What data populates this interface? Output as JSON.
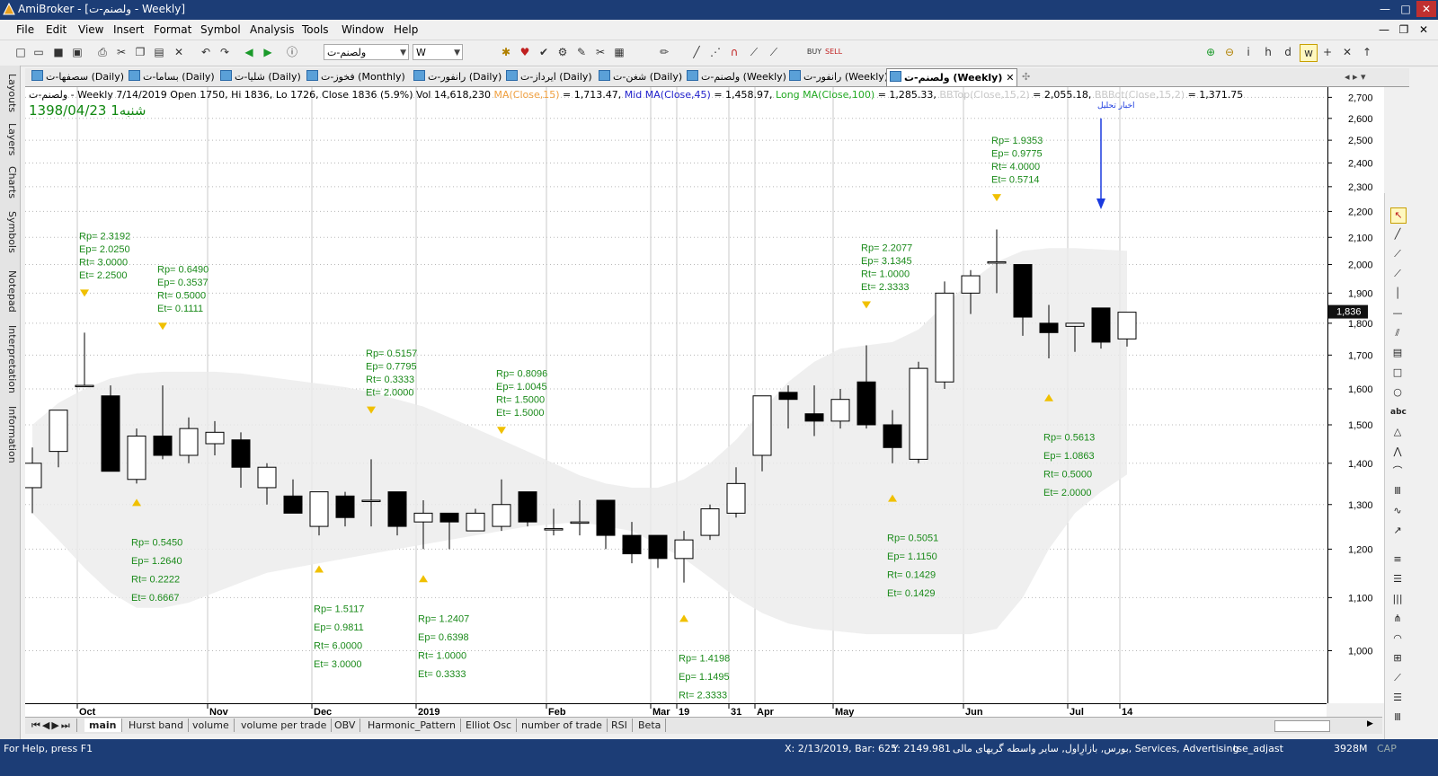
{
  "window": {
    "title": "AmiBroker - [ولصنم-ت - Weekly]",
    "controls": [
      "—",
      "□",
      "✕"
    ],
    "mdi_controls": [
      "—",
      "❐",
      "✕"
    ]
  },
  "menu": [
    "File",
    "Edit",
    "View",
    "Insert",
    "Format",
    "Symbol",
    "Analysis",
    "Tools",
    "Window",
    "Help"
  ],
  "toolbar": {
    "symbol_combo": "ولصنم-ت",
    "interval_combo": "W"
  },
  "left_tabs": [
    "Layouts",
    "Layers",
    "Charts",
    "Symbols",
    "Notepad",
    "Interpretation",
    "Information"
  ],
  "doc_tabs": [
    {
      "label": "سصفها-ت (Daily)",
      "active": false
    },
    {
      "label": "بساما-ت (Daily)",
      "active": false
    },
    {
      "label": "شلیا-ت (Daily)",
      "active": false
    },
    {
      "label": "فخوز-ت (Monthly)",
      "active": false
    },
    {
      "label": "رانفور-ت (Daily)",
      "active": false
    },
    {
      "label": "ایرداز-ت (Daily)",
      "active": false
    },
    {
      "label": "شغن-ت (Daily)",
      "active": false
    },
    {
      "label": "ولصنم-ت (Weekly)",
      "active": false
    },
    {
      "label": "رانفور-ت (Weekly)",
      "active": false
    },
    {
      "label": "ولصنم-ت (Weekly)",
      "active": true
    }
  ],
  "chart_header": {
    "prefix": "ولصنم-ت - Weekly 7/14/2019 Open 1750, Hi 1836, Lo 1726, Close 1836 (5.9%) Vol 14,618,230",
    "ma_label": "MA(Close,15)",
    "ma_value": "= 1,713.47,",
    "mid_label": "Mid MA(Close,45)",
    "mid_value": "= 1,458.97,",
    "long_label": "Long MA(Close,100)",
    "long_value": "= 1,285.33,",
    "bbtop_label": "BBTop(Close,15,2)",
    "bbtop_value": "= 2,055.18,",
    "bbbot_label": "BBBot(Close,15,2)",
    "bbbot_value": "= 1,371.75",
    "colors": {
      "ma": "#f0a040",
      "mid": "#2222cc",
      "long": "#22aa22",
      "bb": "#c8c8c8"
    }
  },
  "jalali_date": "1398/04/23 شنبه1",
  "annotation_text": "اخبار تحلیل",
  "chart_data": {
    "type": "candlestick",
    "ylim": [
      910,
      2750
    ],
    "y_scale": "log",
    "y_ticks": [
      1000,
      1100,
      1200,
      1300,
      1400,
      1500,
      1600,
      1700,
      1800,
      1900,
      2000,
      2100,
      2200,
      2300,
      2400,
      2500,
      2600,
      2700
    ],
    "last_price_label": "1,836",
    "candles": [
      {
        "o": 1340,
        "h": 1440,
        "l": 1280,
        "c": 1400
      },
      {
        "o": 1430,
        "h": 1540,
        "l": 1390,
        "c": 1540
      },
      {
        "o": 1610,
        "h": 1770,
        "l": 1610,
        "c": 1610
      },
      {
        "o": 1580,
        "h": 1610,
        "l": 1380,
        "c": 1380
      },
      {
        "o": 1360,
        "h": 1490,
        "l": 1350,
        "c": 1470
      },
      {
        "o": 1470,
        "h": 1610,
        "l": 1410,
        "c": 1420
      },
      {
        "o": 1420,
        "h": 1520,
        "l": 1400,
        "c": 1490
      },
      {
        "o": 1450,
        "h": 1510,
        "l": 1420,
        "c": 1480
      },
      {
        "o": 1460,
        "h": 1480,
        "l": 1340,
        "c": 1390
      },
      {
        "o": 1340,
        "h": 1400,
        "l": 1300,
        "c": 1390
      },
      {
        "o": 1320,
        "h": 1360,
        "l": 1280,
        "c": 1280
      },
      {
        "o": 1250,
        "h": 1330,
        "l": 1230,
        "c": 1330
      },
      {
        "o": 1320,
        "h": 1330,
        "l": 1250,
        "c": 1270
      },
      {
        "o": 1310,
        "h": 1410,
        "l": 1250,
        "c": 1310
      },
      {
        "o": 1330,
        "h": 1330,
        "l": 1230,
        "c": 1250
      },
      {
        "o": 1260,
        "h": 1310,
        "l": 1200,
        "c": 1280
      },
      {
        "o": 1280,
        "h": 1280,
        "l": 1200,
        "c": 1260
      },
      {
        "o": 1240,
        "h": 1290,
        "l": 1240,
        "c": 1280
      },
      {
        "o": 1250,
        "h": 1360,
        "l": 1240,
        "c": 1300
      },
      {
        "o": 1330,
        "h": 1330,
        "l": 1250,
        "c": 1260
      },
      {
        "o": 1245,
        "h": 1290,
        "l": 1230,
        "c": 1245
      },
      {
        "o": 1260,
        "h": 1310,
        "l": 1230,
        "c": 1260
      },
      {
        "o": 1310,
        "h": 1310,
        "l": 1200,
        "c": 1230
      },
      {
        "o": 1230,
        "h": 1260,
        "l": 1170,
        "c": 1190
      },
      {
        "o": 1230,
        "h": 1230,
        "l": 1160,
        "c": 1180
      },
      {
        "o": 1180,
        "h": 1240,
        "l": 1130,
        "c": 1220
      },
      {
        "o": 1230,
        "h": 1300,
        "l": 1220,
        "c": 1290
      },
      {
        "o": 1280,
        "h": 1390,
        "l": 1270,
        "c": 1350
      },
      {
        "o": 1420,
        "h": 1580,
        "l": 1380,
        "c": 1580
      },
      {
        "o": 1590,
        "h": 1610,
        "l": 1490,
        "c": 1570
      },
      {
        "o": 1530,
        "h": 1610,
        "l": 1470,
        "c": 1510
      },
      {
        "o": 1510,
        "h": 1600,
        "l": 1490,
        "c": 1570
      },
      {
        "o": 1620,
        "h": 1730,
        "l": 1490,
        "c": 1500
      },
      {
        "o": 1500,
        "h": 1540,
        "l": 1400,
        "c": 1440
      },
      {
        "o": 1410,
        "h": 1680,
        "l": 1400,
        "c": 1660
      },
      {
        "o": 1620,
        "h": 1940,
        "l": 1600,
        "c": 1900
      },
      {
        "o": 1900,
        "h": 1980,
        "l": 1830,
        "c": 1960
      },
      {
        "o": 2010,
        "h": 2130,
        "l": 1900,
        "c": 2010
      },
      {
        "o": 2000,
        "h": 2000,
        "l": 1760,
        "c": 1820
      },
      {
        "o": 1800,
        "h": 1860,
        "l": 1690,
        "c": 1770
      },
      {
        "o": 1790,
        "h": 1800,
        "l": 1710,
        "c": 1800
      },
      {
        "o": 1850,
        "h": 1850,
        "l": 1720,
        "c": 1740
      },
      {
        "o": 1750,
        "h": 1836,
        "l": 1726,
        "c": 1836
      }
    ],
    "bb_top": [
      1500,
      1560,
      1600,
      1630,
      1645,
      1650,
      1650,
      1650,
      1645,
      1635,
      1625,
      1615,
      1605,
      1590,
      1570,
      1550,
      1520,
      1490,
      1460,
      1430,
      1400,
      1370,
      1350,
      1340,
      1340,
      1360,
      1400,
      1460,
      1540,
      1620,
      1680,
      1720,
      1730,
      1740,
      1780,
      1860,
      1940,
      2010,
      2050,
      2060,
      2060,
      2055,
      2050
    ],
    "bb_bot": [
      1280,
      1220,
      1160,
      1110,
      1080,
      1080,
      1090,
      1110,
      1130,
      1150,
      1160,
      1170,
      1180,
      1190,
      1200,
      1210,
      1220,
      1230,
      1240,
      1250,
      1255,
      1260,
      1250,
      1240,
      1210,
      1180,
      1140,
      1100,
      1070,
      1050,
      1040,
      1035,
      1030,
      1030,
      1030,
      1030,
      1030,
      1040,
      1100,
      1200,
      1280,
      1330,
      1372
    ],
    "signals": [
      {
        "idx": 2,
        "dir": "down",
        "price": 1900,
        "text": {
          "rp": "2.3192",
          "ep": "2.0250",
          "rt": "3.0000",
          "et": "2.2500"
        },
        "label": "above"
      },
      {
        "idx": 5,
        "dir": "down",
        "price": 1790,
        "text": {
          "rp": "0.6490",
          "ep": "0.3537",
          "rt": "0.5000",
          "et": "0.1111"
        },
        "label": "above"
      },
      {
        "idx": 4,
        "dir": "up",
        "price": 1305,
        "text": {
          "rp": "0.5450",
          "ep": "1.2640",
          "rt": "0.2222",
          "et": "0.6667"
        },
        "label": "below"
      },
      {
        "idx": 11,
        "dir": "up",
        "price": 1158,
        "text": {
          "rp": "1.5117",
          "ep": "0.9811",
          "rt": "6.0000",
          "et": "3.0000"
        },
        "label": "below"
      },
      {
        "idx": 13,
        "dir": "down",
        "price": 1540,
        "text": {
          "rp": "0.5157",
          "ep": "0.7795",
          "rt": "0.3333",
          "et": "2.0000"
        },
        "label": "above"
      },
      {
        "idx": 15,
        "dir": "up",
        "price": 1138,
        "text": {
          "rp": "1.2407",
          "ep": "0.6398",
          "rt": "1.0000",
          "et": "0.3333"
        },
        "label": "below"
      },
      {
        "idx": 18,
        "dir": "down",
        "price": 1485,
        "text": {
          "rp": "0.8096",
          "ep": "1.0045",
          "rt": "1.5000",
          "et": "1.5000"
        },
        "label": "above"
      },
      {
        "idx": 25,
        "dir": "up",
        "price": 1060,
        "text": {
          "rp": "1.4198",
          "ep": "1.1495",
          "rt": "2.3333",
          "et": ""
        },
        "label": "below"
      },
      {
        "idx": 32,
        "dir": "down",
        "price": 1860,
        "text": {
          "rp": "2.2077",
          "ep": "3.1345",
          "rt": "1.0000",
          "et": "2.3333"
        },
        "label": "above"
      },
      {
        "idx": 33,
        "dir": "up",
        "price": 1315,
        "text": {
          "rp": "0.5051",
          "ep": "1.1150",
          "rt": "0.1429",
          "et": "0.1429"
        },
        "label": "below"
      },
      {
        "idx": 37,
        "dir": "down",
        "price": 2255,
        "text": {
          "rp": "1.9353",
          "ep": "0.9775",
          "rt": "4.0000",
          "et": "0.5714"
        },
        "label": "above"
      },
      {
        "idx": 39,
        "dir": "up",
        "price": 1575,
        "text": {
          "rp": "0.5613",
          "ep": "1.0863",
          "rt": "0.5000",
          "et": "2.0000"
        },
        "label": "below"
      }
    ],
    "x_labels": [
      {
        "idx": 2,
        "text": "Oct"
      },
      {
        "idx": 7,
        "text": "Nov"
      },
      {
        "idx": 11,
        "text": "Dec"
      },
      {
        "idx": 15,
        "text": "2019"
      },
      {
        "idx": 20,
        "text": "Feb"
      },
      {
        "idx": 24,
        "text": "Mar"
      },
      {
        "idx": 25,
        "text": "19"
      },
      {
        "idx": 27,
        "text": "31"
      },
      {
        "idx": 28,
        "text": "Apr"
      },
      {
        "idx": 31,
        "text": "May"
      },
      {
        "idx": 36,
        "text": "Jun"
      },
      {
        "idx": 40,
        "text": "Jul"
      },
      {
        "idx": 42,
        "text": "14"
      }
    ]
  },
  "sheet_tabs": [
    "main",
    "Hurst band",
    "volume",
    "volume per trade",
    "OBV",
    "Harmonic_Pattern",
    "Elliot Osc",
    "number of trade",
    "RSI",
    "Beta"
  ],
  "statusbar": {
    "help": "For Help, press F1",
    "coords": "X: 2/13/2019, Bar: 625",
    "yval": "Y: 2149.981",
    "sector": "بورس, بازارِاول, سایر واسطه گریهای مالی, Services, Advertising",
    "db": "tse_adjast",
    "mem": "3928M",
    "cap": "CAP"
  }
}
